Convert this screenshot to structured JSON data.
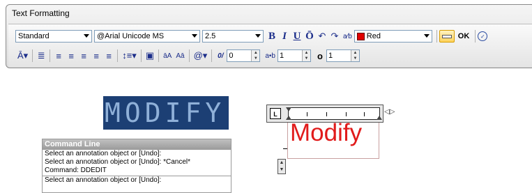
{
  "window": {
    "title": "Text Formatting"
  },
  "toolbar": {
    "style_value": "Standard",
    "font_value": "@Arial Unicode MS",
    "height_value": "2.5",
    "bold_label": "B",
    "italic_label": "I",
    "underline_label": "U",
    "overline_label": "Ō",
    "color_value": "Red",
    "ok_label": "OK",
    "oblique_value": "0",
    "tracking_value": "1",
    "width_value": "1",
    "colors": {
      "text": "#e11b1b",
      "banner_bg": "#1c3f74"
    }
  },
  "banner": {
    "text": "MODIFY"
  },
  "command_line": {
    "title": "Command Line",
    "lines": [
      "Select an annotation object or [Undo]:",
      "Select an annotation object or [Undo]: *Cancel*",
      "Command: DDEDIT",
      "Select an annotation object or [Undo]:"
    ]
  },
  "editor": {
    "ruler_label": "L",
    "text": "Modify"
  }
}
